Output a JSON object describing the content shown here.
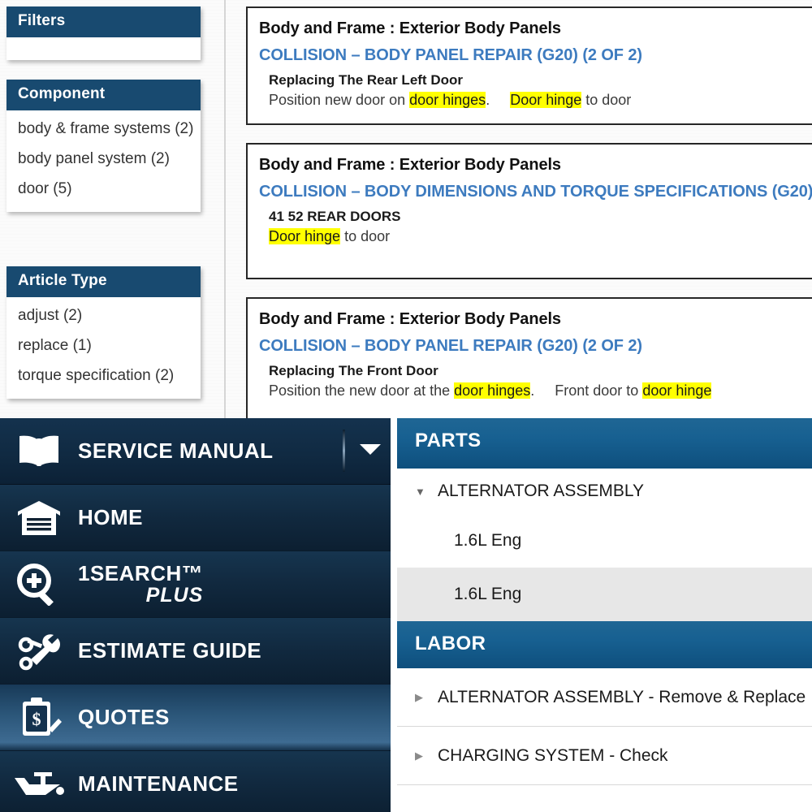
{
  "facets": {
    "panels": [
      {
        "title": "Filters",
        "items": []
      },
      {
        "title": "Component",
        "items": [
          "body & frame systems (2)",
          "body panel system (2)",
          "door (5)"
        ]
      },
      {
        "title": "Article Type",
        "items": [
          "adjust (2)",
          "replace (1)",
          "torque specification (2)"
        ]
      }
    ]
  },
  "results": [
    {
      "breadcrumb": "Body and Frame : Exterior Body Panels",
      "title": "COLLISION – BODY PANEL REPAIR (G20) (2 OF 2)",
      "subtitle": "Replacing The Rear Left Door",
      "snippet_parts": [
        {
          "text": "Position new door on ",
          "highlight": false
        },
        {
          "text": "door hinges",
          "highlight": true
        },
        {
          "text": ".     ",
          "highlight": false
        },
        {
          "text": "Door hinge",
          "highlight": true
        },
        {
          "text": " to door",
          "highlight": false
        }
      ]
    },
    {
      "breadcrumb": "Body and Frame : Exterior Body Panels",
      "title": "COLLISION – BODY DIMENSIONS AND TORQUE SPECIFICATIONS (G20)",
      "subtitle": "41 52 REAR DOORS",
      "snippet_parts": [
        {
          "text": "Door hinge",
          "highlight": true
        },
        {
          "text": " to door",
          "highlight": false
        }
      ]
    },
    {
      "breadcrumb": "Body and Frame : Exterior Body Panels",
      "title": "COLLISION – BODY PANEL REPAIR (G20) (2 OF 2)",
      "subtitle": "Replacing The Front Door",
      "snippet_parts": [
        {
          "text": "Position the new door at the ",
          "highlight": false
        },
        {
          "text": "door hinges",
          "highlight": true
        },
        {
          "text": ".     ",
          "highlight": false
        },
        {
          "text": "Front door to ",
          "highlight": false
        },
        {
          "text": "door hinge",
          "highlight": true
        }
      ]
    }
  ],
  "nav": {
    "items": [
      {
        "label": "SERVICE MANUAL",
        "sublabel": "",
        "icon": "open-book-icon",
        "state": "brand"
      },
      {
        "label": "HOME",
        "sublabel": "",
        "icon": "garage-icon",
        "state": "normal"
      },
      {
        "label": "1SEARCH™",
        "sublabel": "PLUS",
        "icon": "magnifier-plus-icon",
        "state": "normal"
      },
      {
        "label": "ESTIMATE GUIDE",
        "sublabel": "",
        "icon": "tools-icon",
        "state": "normal"
      },
      {
        "label": "QUOTES",
        "sublabel": "",
        "icon": "clipboard-dollar-icon",
        "state": "active"
      },
      {
        "label": "MAINTENANCE",
        "sublabel": "",
        "icon": "oil-can-icon",
        "state": "normal"
      }
    ],
    "dropdown_caret": "chevron-down-icon"
  },
  "parts": {
    "header": "PARTS",
    "group": "ALTERNATOR ASSEMBLY",
    "children": [
      {
        "label": "1.6L Eng",
        "selected": false
      },
      {
        "label": "1.6L Eng",
        "selected": true
      }
    ]
  },
  "labor": {
    "header": "LABOR",
    "rows": [
      "ALTERNATOR ASSEMBLY - Remove & Replace",
      "CHARGING SYSTEM - Check"
    ]
  },
  "colors": {
    "facet_header": "#184a70",
    "link_blue": "#3d7bbf",
    "section_blue": "#176091",
    "highlight_yellow": "#ffff00",
    "nav_dark": "#0d2236",
    "nav_active": "#3e6b92",
    "selected_row": "#e7e7e7"
  }
}
